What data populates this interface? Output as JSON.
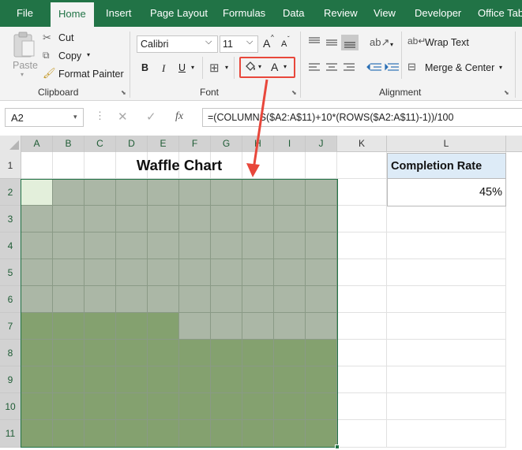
{
  "ribbon": {
    "tabs": [
      {
        "label": "File",
        "active": false
      },
      {
        "label": "Home",
        "active": true
      },
      {
        "label": "Insert",
        "active": false
      },
      {
        "label": "Page Layout",
        "active": false
      },
      {
        "label": "Formulas",
        "active": false
      },
      {
        "label": "Data",
        "active": false
      },
      {
        "label": "Review",
        "active": false
      },
      {
        "label": "View",
        "active": false
      },
      {
        "label": "Developer",
        "active": false
      },
      {
        "label": "Office Tab",
        "active": false
      }
    ],
    "clipboard": {
      "paste_label": "Paste",
      "cut_label": "Cut",
      "copy_label": "Copy",
      "format_painter_label": "Format Painter",
      "group_label": "Clipboard"
    },
    "font": {
      "font_name": "Calibri",
      "font_size": "11",
      "bold": "B",
      "italic": "I",
      "underline": "U",
      "font_color_glyph": "A",
      "grow_glyph": "A",
      "shrink_glyph": "A",
      "group_label": "Font"
    },
    "alignment": {
      "wrap_text_label": "Wrap Text",
      "merge_center_label": "Merge & Center",
      "group_label": "Alignment"
    }
  },
  "formula_bar": {
    "name_box": "A2",
    "fx": "fx",
    "formula": "=(COLUMNS($A2:A$11)+10*(ROWS($A2:A$11)-1))/100"
  },
  "sheet": {
    "columns": [
      "A",
      "B",
      "C",
      "D",
      "E",
      "F",
      "G",
      "H",
      "I",
      "J",
      "K",
      "L"
    ],
    "rows": [
      "1",
      "2",
      "3",
      "4",
      "5",
      "6",
      "7",
      "8",
      "9",
      "10",
      "11"
    ],
    "title": "Waffle Chart",
    "completion_header": "Completion Rate",
    "completion_value": "45%",
    "completion_rate": 0.45,
    "active_cell": "A2"
  },
  "colors": {
    "ribbon_green": "#217346",
    "filled_cell": "#84a16f",
    "empty_cell": "#abb7a6",
    "active_cell_fill": "#e3efdb",
    "header_fill": "#ddebf7",
    "annotation_red": "#e8473b"
  },
  "chart_data": {
    "type": "table",
    "title": "Waffle Chart",
    "grid_rows": 10,
    "grid_cols": 10,
    "filled_fraction": 0.45
  }
}
